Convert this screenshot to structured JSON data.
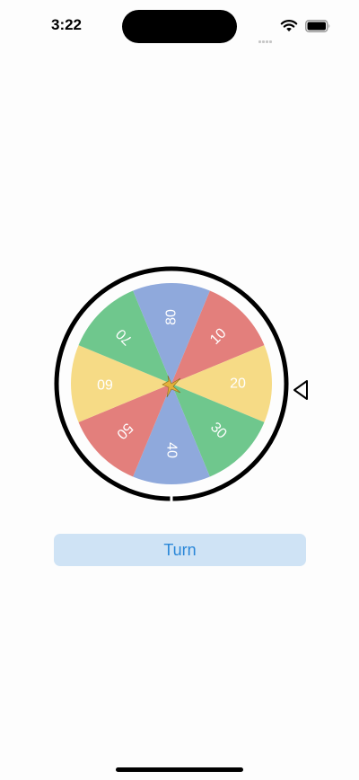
{
  "status_bar": {
    "time": "3:22"
  },
  "wheel": {
    "segments": [
      {
        "label": "10",
        "color": "#e37f7c"
      },
      {
        "label": "20",
        "color": "#f6db86"
      },
      {
        "label": "30",
        "color": "#6fc78d"
      },
      {
        "label": "40",
        "color": "#8fa9dc"
      },
      {
        "label": "50",
        "color": "#e37f7c"
      },
      {
        "label": "60",
        "color": "#f6db86"
      },
      {
        "label": "70",
        "color": "#6fc78d"
      },
      {
        "label": "80",
        "color": "#8fa9dc"
      }
    ],
    "pointer_icon": "triangle-left-outline",
    "center_icon": "star"
  },
  "turn_button": {
    "label": "Turn"
  }
}
